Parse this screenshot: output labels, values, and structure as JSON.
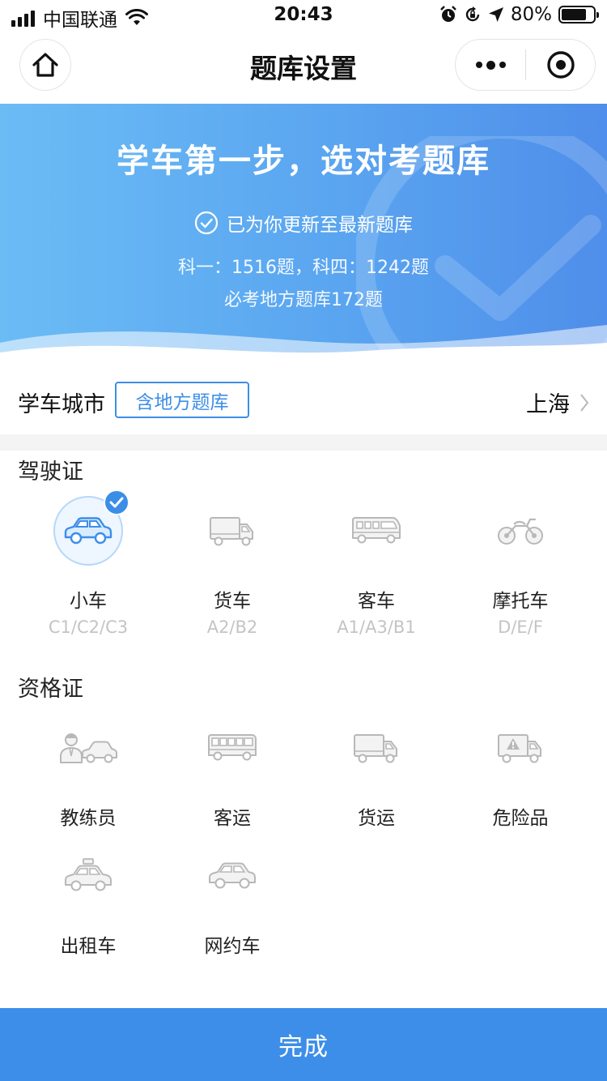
{
  "status_bar": {
    "carrier": "中国联通",
    "time": "20:43",
    "battery": "80%",
    "battery_level": 0.8
  },
  "nav": {
    "title": "题库设置"
  },
  "banner": {
    "title": "学车第一步，选对考题库",
    "updated": "已为你更新至最新题库",
    "counts": "科一：1516题，科四：1242题",
    "local": "必考地方题库172题",
    "gradient_colors": [
      "#6bbcf5",
      "#4f8eea"
    ]
  },
  "city": {
    "label": "学车城市",
    "tag": "含地方题库",
    "value": "上海"
  },
  "license": {
    "title": "驾驶证",
    "items": [
      {
        "label": "小车",
        "sub": "C1/C2/C3",
        "icon": "car-icon",
        "selected": true
      },
      {
        "label": "货车",
        "sub": "A2/B2",
        "icon": "truck-icon",
        "selected": false
      },
      {
        "label": "客车",
        "sub": "A1/A3/B1",
        "icon": "bus-icon",
        "selected": false
      },
      {
        "label": "摩托车",
        "sub": "D/E/F",
        "icon": "motorcycle-icon",
        "selected": false
      }
    ]
  },
  "qualification": {
    "title": "资格证",
    "items": [
      {
        "label": "教练员",
        "icon": "coach-icon"
      },
      {
        "label": "客运",
        "icon": "bus-icon"
      },
      {
        "label": "货运",
        "icon": "truck-icon"
      },
      {
        "label": "危险品",
        "icon": "hazmat-truck-icon"
      },
      {
        "label": "出租车",
        "icon": "taxi-icon"
      },
      {
        "label": "网约车",
        "icon": "car-icon"
      }
    ]
  },
  "done_label": "完成",
  "accent_color": "#3d8ee8"
}
